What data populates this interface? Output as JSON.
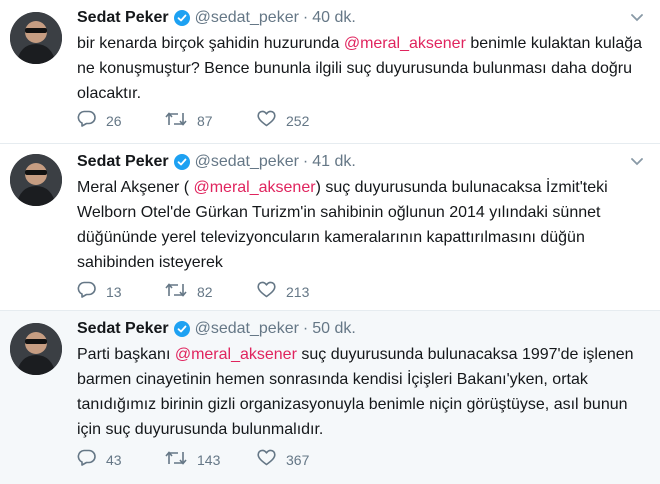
{
  "tweets": [
    {
      "user_name": "Sedat Peker",
      "handle": "@sedat_peker",
      "dot": "·",
      "time": "40 dk.",
      "text_before": "bir kenarda birçok şahidin huzurunda ",
      "mention": "@meral_aksener",
      "text_after": " benimle kulaktan kulağa ne konuşmuştur? Bence bununla ilgili suç duyurusunda bulunması daha doğru olacaktır.",
      "replies": "26",
      "retweets": "87",
      "likes": "252"
    },
    {
      "user_name": "Sedat Peker",
      "handle": "@sedat_peker",
      "dot": "·",
      "time": "41 dk.",
      "text_before": "Meral Akşener (  ",
      "mention": "@meral_aksener",
      "text_after": ")  suç duyurusunda bulunacaksa İzmit'teki Welborn Otel'de Gürkan Turizm'in sahibinin oğlunun 2014 yılındaki sünnet düğününde yerel televizyoncuların  kameralarının kapattırılmasını düğün sahibinden isteyerek",
      "replies": "13",
      "retweets": "82",
      "likes": "213"
    },
    {
      "user_name": "Sedat Peker",
      "handle": "@sedat_peker",
      "dot": "·",
      "time": "50 dk.",
      "text_before": "Parti başkanı ",
      "mention": "@meral_aksener",
      "text_after": "  suç duyurusunda bulunacaksa 1997'de işlenen barmen cinayetinin hemen sonrasında kendisi İçişleri Bakanı'yken, ortak tanıdığımız birinin gizli organizasyonuyla benimle niçin görüştüyse, asıl bunun için suç duyurusunda bulunmalıdır.",
      "replies": "43",
      "retweets": "143",
      "likes": "367"
    }
  ],
  "icons": {
    "verified": "verified-badge-icon",
    "caret": "chevron-down-icon",
    "reply": "reply-icon",
    "retweet": "retweet-icon",
    "like": "heart-icon"
  },
  "colors": {
    "mention": "#e0245e",
    "verified": "#1da1f2",
    "muted": "#657786",
    "highlight_bg": "#f5f8fa"
  }
}
